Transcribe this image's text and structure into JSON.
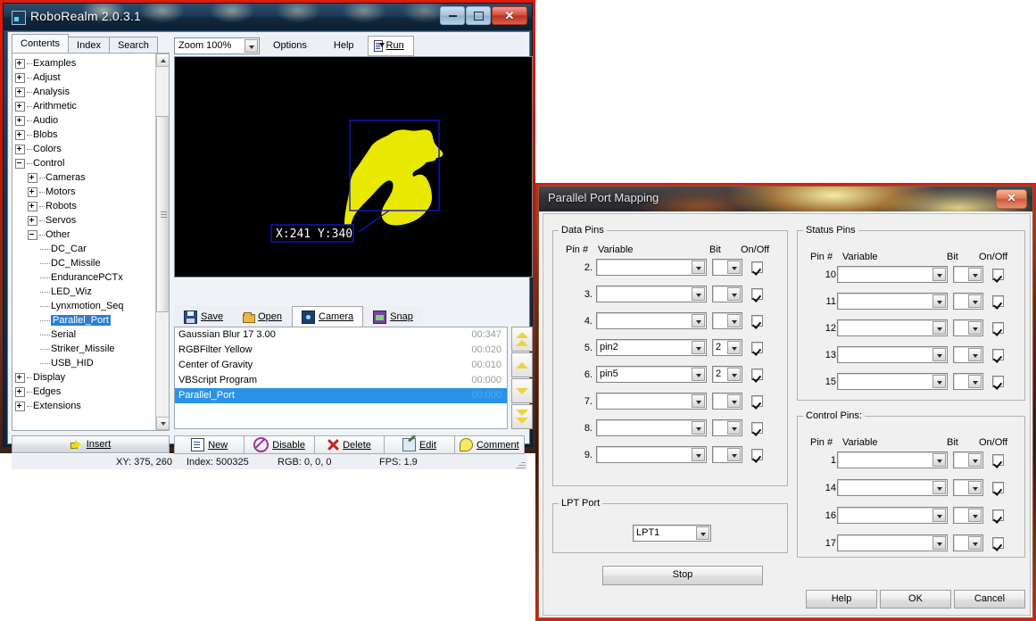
{
  "main_window": {
    "title": "RoboRealm 2.0.3.1",
    "window_buttons": {
      "minimize": "minimize-button",
      "maximize": "maximize-button",
      "close": "✕"
    },
    "tabs": [
      {
        "label": "Contents",
        "active": true
      },
      {
        "label": "Index",
        "active": false
      },
      {
        "label": "Search",
        "active": false
      }
    ],
    "tree": [
      {
        "label": "Examples",
        "indent": 0,
        "expander": "plus",
        "selected": false
      },
      {
        "label": "Adjust",
        "indent": 0,
        "expander": "plus",
        "selected": false
      },
      {
        "label": "Analysis",
        "indent": 0,
        "expander": "plus",
        "selected": false
      },
      {
        "label": "Arithmetic",
        "indent": 0,
        "expander": "plus",
        "selected": false
      },
      {
        "label": "Audio",
        "indent": 0,
        "expander": "plus",
        "selected": false
      },
      {
        "label": "Blobs",
        "indent": 0,
        "expander": "plus",
        "selected": false
      },
      {
        "label": "Colors",
        "indent": 0,
        "expander": "plus",
        "selected": false
      },
      {
        "label": "Control",
        "indent": 0,
        "expander": "minus",
        "selected": false
      },
      {
        "label": "Cameras",
        "indent": 1,
        "expander": "plus",
        "selected": false
      },
      {
        "label": "Motors",
        "indent": 1,
        "expander": "plus",
        "selected": false
      },
      {
        "label": "Robots",
        "indent": 1,
        "expander": "plus",
        "selected": false
      },
      {
        "label": "Servos",
        "indent": 1,
        "expander": "plus",
        "selected": false
      },
      {
        "label": "Other",
        "indent": 1,
        "expander": "minus",
        "selected": false
      },
      {
        "label": "DC_Car",
        "indent": 2,
        "expander": "leaf",
        "selected": false
      },
      {
        "label": "DC_Missile",
        "indent": 2,
        "expander": "leaf",
        "selected": false
      },
      {
        "label": "EndurancePCTx",
        "indent": 2,
        "expander": "leaf",
        "selected": false
      },
      {
        "label": "LED_Wiz",
        "indent": 2,
        "expander": "leaf",
        "selected": false
      },
      {
        "label": "Lynxmotion_Seq",
        "indent": 2,
        "expander": "leaf",
        "selected": false
      },
      {
        "label": "Parallel_Port",
        "indent": 2,
        "expander": "leaf",
        "selected": true
      },
      {
        "label": "Serial",
        "indent": 2,
        "expander": "leaf",
        "selected": false
      },
      {
        "label": "Striker_Missile",
        "indent": 2,
        "expander": "leaf",
        "selected": false
      },
      {
        "label": "USB_HID",
        "indent": 2,
        "expander": "leaf",
        "selected": false
      },
      {
        "label": "Display",
        "indent": 0,
        "expander": "plus",
        "selected": false
      },
      {
        "label": "Edges",
        "indent": 0,
        "expander": "plus",
        "selected": false
      },
      {
        "label": "Extensions",
        "indent": 0,
        "expander": "plus",
        "selected": false
      }
    ],
    "insert_button": "Insert",
    "toolbar": {
      "zoom_value": "Zoom 100%",
      "options": "Options",
      "help": "Help",
      "run": "Run"
    },
    "video": {
      "overlay_label": "X:241 Y:340",
      "box_color": "#0000cd",
      "blob_color": "#e8e800",
      "background": "#000000"
    },
    "io_buttons": [
      {
        "label": "Save",
        "icon": "floppy-disk-icon",
        "active": false
      },
      {
        "label": "Open",
        "icon": "folder-open-icon",
        "active": false
      },
      {
        "label": "Camera",
        "icon": "camera-icon",
        "active": true
      },
      {
        "label": "Snap",
        "icon": "snapshot-icon",
        "active": false
      }
    ],
    "pipeline": [
      {
        "name": "Gaussian Blur 17  3.00",
        "time": "00:347",
        "selected": false
      },
      {
        "name": "RGBFilter Yellow",
        "time": "00:020",
        "selected": false
      },
      {
        "name": "Center of Gravity",
        "time": "00:010",
        "selected": false
      },
      {
        "name": "VBScript Program",
        "time": "00:000",
        "selected": false
      },
      {
        "name": "Parallel_Port",
        "time": "00:000",
        "selected": true
      }
    ],
    "move_buttons": [
      "move-to-top-button",
      "move-up-button",
      "move-down-button",
      "move-to-bottom-button"
    ],
    "pipeline_buttons": [
      {
        "label": "New",
        "icon": "new-document-icon"
      },
      {
        "label": "Disable",
        "icon": "disable-icon"
      },
      {
        "label": "Delete",
        "icon": "delete-x-icon"
      },
      {
        "label": "Edit",
        "icon": "edit-icon"
      },
      {
        "label": "Comment",
        "icon": "comment-bubble-icon"
      }
    ],
    "status": {
      "xy": "XY: 375, 260",
      "index": "Index: 500325",
      "rgb": "RGB: 0, 0, 0",
      "fps": "FPS: 1.9"
    }
  },
  "dialog": {
    "title": "Parallel Port Mapping",
    "close_glyph": "✕",
    "data_pins": {
      "legend": "Data Pins",
      "headers": {
        "pin": "Pin #",
        "variable": "Variable",
        "bit": "Bit",
        "onoff": "On/Off"
      },
      "rows": [
        {
          "pin": "2.",
          "variable": "",
          "bit": "",
          "checked": true
        },
        {
          "pin": "3.",
          "variable": "",
          "bit": "",
          "checked": true
        },
        {
          "pin": "4.",
          "variable": "",
          "bit": "",
          "checked": true
        },
        {
          "pin": "5.",
          "variable": "pin2",
          "bit": "2",
          "checked": true
        },
        {
          "pin": "6.",
          "variable": "pin5",
          "bit": "2",
          "checked": true
        },
        {
          "pin": "7.",
          "variable": "",
          "bit": "",
          "checked": true
        },
        {
          "pin": "8.",
          "variable": "",
          "bit": "",
          "checked": true
        },
        {
          "pin": "9.",
          "variable": "",
          "bit": "",
          "checked": true
        }
      ]
    },
    "status_pins": {
      "legend": "Status Pins",
      "headers": {
        "pin": "Pin #",
        "variable": "Variable",
        "bit": "Bit",
        "onoff": "On/Off"
      },
      "rows": [
        {
          "pin": "10.",
          "variable": "",
          "bit": "",
          "checked": true
        },
        {
          "pin": "11.",
          "variable": "",
          "bit": "",
          "checked": true
        },
        {
          "pin": "12.",
          "variable": "",
          "bit": "",
          "checked": true
        },
        {
          "pin": "13.",
          "variable": "",
          "bit": "",
          "checked": true
        },
        {
          "pin": "15.",
          "variable": "",
          "bit": "",
          "checked": true
        }
      ]
    },
    "control_pins": {
      "legend": "Control Pins:",
      "headers": {
        "pin": "Pin #",
        "variable": "Variable",
        "bit": "Bit",
        "onoff": "On/Off"
      },
      "rows": [
        {
          "pin": "1.",
          "variable": "",
          "bit": "",
          "checked": true
        },
        {
          "pin": "14.",
          "variable": "",
          "bit": "",
          "checked": true
        },
        {
          "pin": "16.",
          "variable": "",
          "bit": "",
          "checked": true
        },
        {
          "pin": "17.",
          "variable": "",
          "bit": "",
          "checked": true
        }
      ]
    },
    "lpt_port": {
      "legend": "LPT Port",
      "value": "LPT1"
    },
    "stop_button": "Stop",
    "footer_buttons": {
      "help": "Help",
      "ok": "OK",
      "cancel": "Cancel"
    }
  }
}
